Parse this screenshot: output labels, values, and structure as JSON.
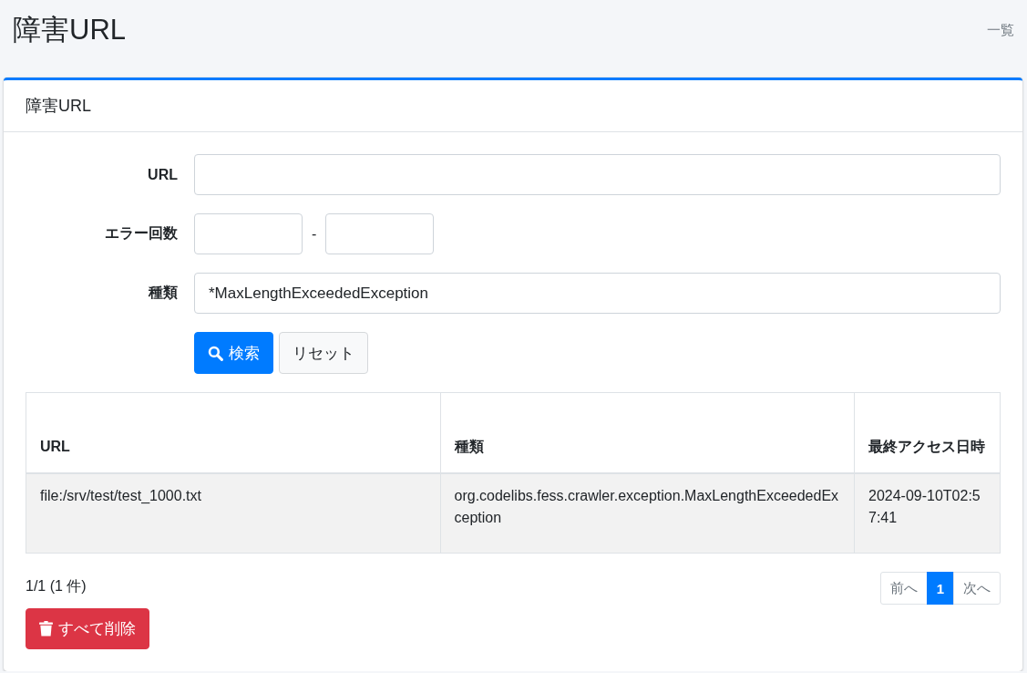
{
  "page": {
    "title": "障害URL",
    "breadcrumb": "一覧"
  },
  "card": {
    "title": "障害URL"
  },
  "form": {
    "fields": [
      {
        "kind": "text",
        "label": "URL"
      },
      {
        "kind": "range",
        "label": "エラー回数",
        "separator": "-"
      },
      {
        "kind": "text",
        "label": "種類",
        "value": "*MaxLengthExceededException"
      }
    ],
    "buttons": [
      {
        "kind": "primary",
        "label": "検索"
      },
      {
        "kind": "secondary",
        "label": "リセット"
      }
    ]
  },
  "table": {
    "columns": [
      "URL",
      "種類",
      "最終アクセス日時"
    ],
    "rows": [
      [
        "file:/srv/test/test_1000.txt",
        "org.codelibs.fess.crawler.exception.MaxLengthExceededException",
        "2024-09-10T02:57:41"
      ]
    ]
  },
  "summary": "1/1 (1 件)",
  "pagination": [
    {
      "label": "前へ",
      "selected": false,
      "disabled": true
    },
    {
      "label": "1",
      "selected": true,
      "disabled": false
    },
    {
      "label": "次へ",
      "selected": false,
      "disabled": true
    }
  ],
  "delete_button": {
    "label": "すべて削除"
  }
}
